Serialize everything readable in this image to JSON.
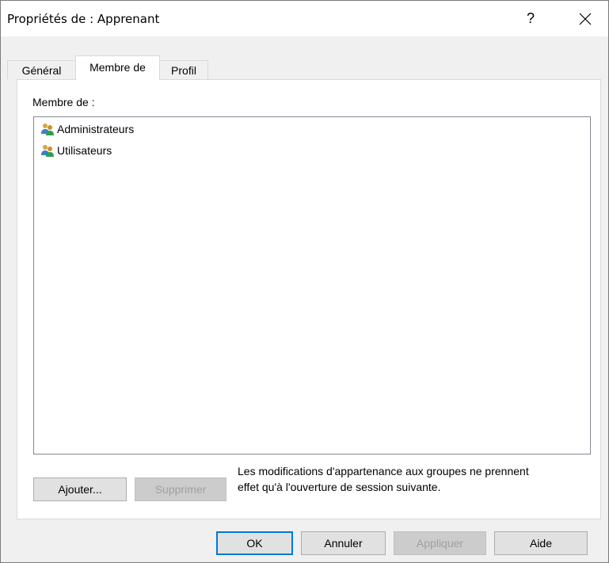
{
  "window": {
    "title": "Propriétés de : Apprenant",
    "help_label": "?",
    "close_icon": "close-icon"
  },
  "tabs": [
    {
      "label": "Général",
      "selected": false
    },
    {
      "label": "Membre de",
      "selected": true
    },
    {
      "label": "Profil",
      "selected": false
    }
  ],
  "membre": {
    "label": "Membre de :",
    "groups": [
      {
        "name": "Administrateurs",
        "icon": "group-icon"
      },
      {
        "name": "Utilisateurs",
        "icon": "group-icon"
      }
    ],
    "add_label": "Ajouter...",
    "remove_label": "Supprimer",
    "note_line1": "Les modifications d'appartenance aux groupes ne prennent",
    "note_line2": "effet qu'à l'ouverture de session suivante."
  },
  "footer": {
    "ok_label": "OK",
    "cancel_label": "Annuler",
    "apply_label": "Appliquer",
    "help_label": "Aide"
  },
  "colors": {
    "accent": "#0078d7",
    "disabled_text": "#a0a0a0"
  }
}
